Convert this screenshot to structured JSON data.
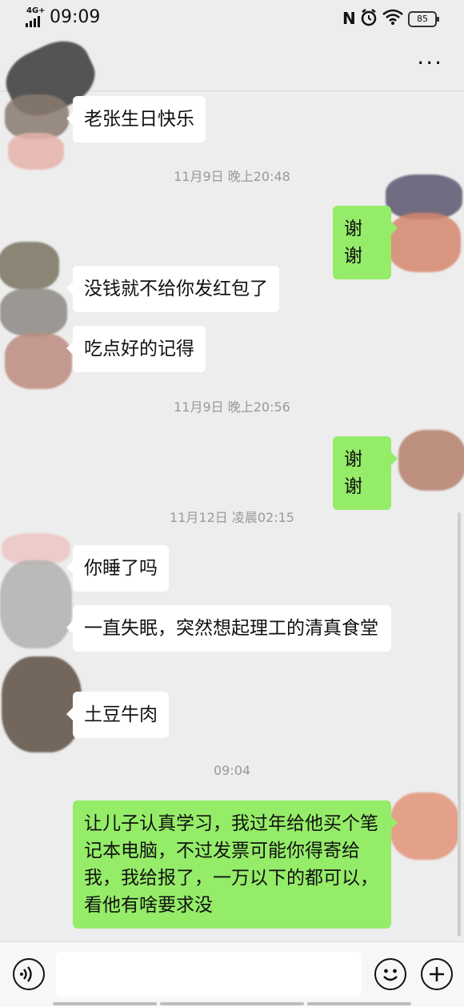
{
  "status": {
    "network": "4G+",
    "time": "09:09",
    "nfc": "N",
    "battery": "85"
  },
  "header": {
    "more_label": "···"
  },
  "messages": [
    {
      "type": "text",
      "side": "left",
      "text": "老张生日快乐"
    },
    {
      "type": "time",
      "text": "11月9日 晚上20:48"
    },
    {
      "type": "text",
      "side": "right",
      "text": "谢谢"
    },
    {
      "type": "text",
      "side": "left",
      "text": "没钱就不给你发红包了"
    },
    {
      "type": "text",
      "side": "left",
      "text": "吃点好的记得"
    },
    {
      "type": "time",
      "text": "11月9日 晚上20:56"
    },
    {
      "type": "text",
      "side": "right",
      "text": "谢谢"
    },
    {
      "type": "time",
      "text": "11月12日 凌晨02:15"
    },
    {
      "type": "text",
      "side": "left",
      "text": "你睡了吗"
    },
    {
      "type": "text",
      "side": "left",
      "text": "一直失眠，突然想起理工的清真食堂"
    },
    {
      "type": "text",
      "side": "left",
      "text": "土豆牛肉"
    },
    {
      "type": "time",
      "text": "09:04"
    },
    {
      "type": "text",
      "side": "right",
      "text": "让儿子认真学习，我过年给他买个笔记本电脑，不过发票可能你得寄给我，我给报了，一万以下的都可以，看他有啥要求没"
    }
  ],
  "input": {
    "voice_icon": "voice-icon",
    "emoji_icon": "emoji-icon",
    "plus_icon": "plus-icon"
  },
  "colors": {
    "background": "#ededed",
    "sent_bubble": "#95ec69",
    "received_bubble": "#ffffff"
  }
}
